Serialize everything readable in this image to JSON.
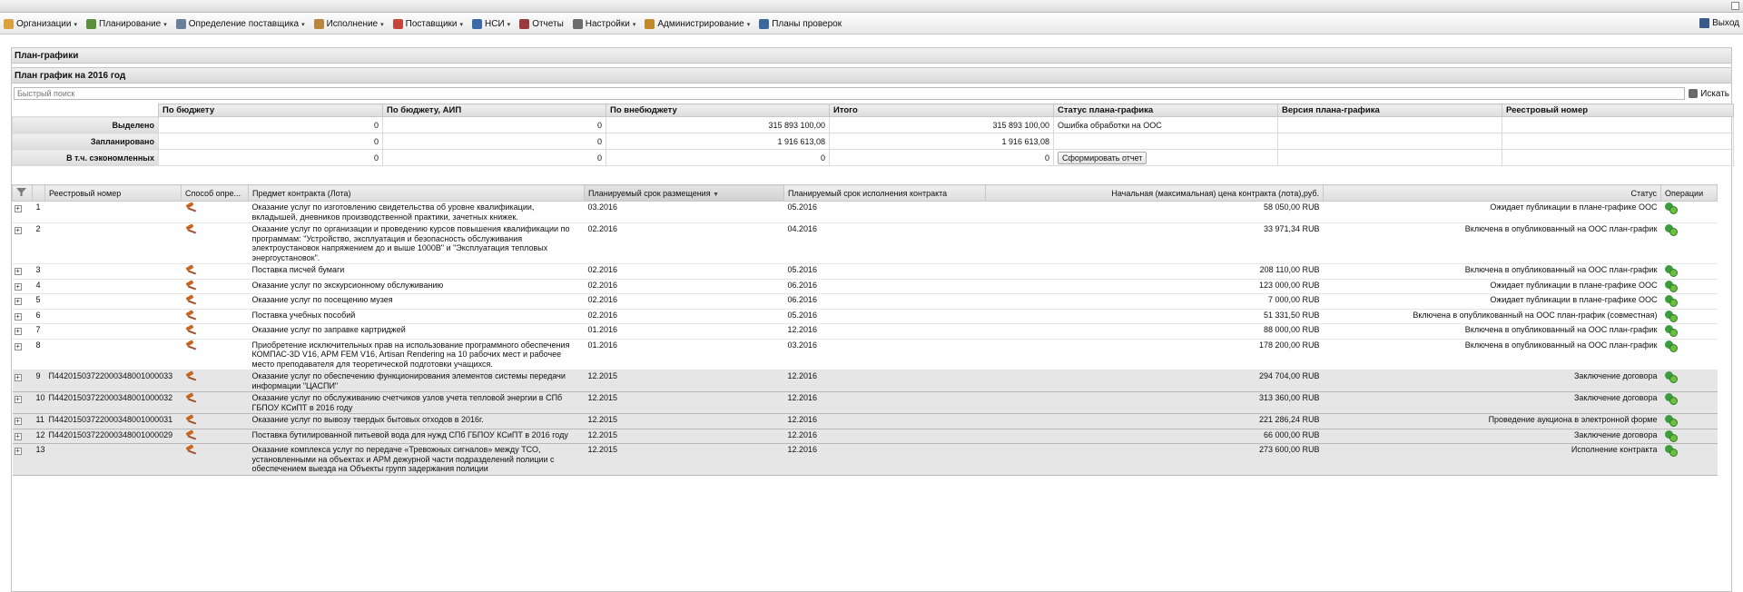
{
  "menu": {
    "items": [
      {
        "label": "Организации",
        "icon": "building-icon",
        "color": "#d9a23a",
        "arrow": true
      },
      {
        "label": "Планирование",
        "icon": "list-icon",
        "color": "#5c8f3a",
        "arrow": true
      },
      {
        "label": "Определение поставщика",
        "icon": "gear-icon",
        "color": "#6a7f9a",
        "arrow": true
      },
      {
        "label": "Исполнение",
        "icon": "briefcase-icon",
        "color": "#b8863c",
        "arrow": true
      },
      {
        "label": "Поставщики",
        "icon": "truck-icon",
        "color": "#c4463a",
        "arrow": true
      },
      {
        "label": "НСИ",
        "icon": "table-icon",
        "color": "#3a6aa8",
        "arrow": true
      },
      {
        "label": "Отчеты",
        "icon": "report-icon",
        "color": "#9a3a3a",
        "arrow": false
      },
      {
        "label": "Настройки",
        "icon": "wrench-icon",
        "color": "#6a6a6a",
        "arrow": true
      },
      {
        "label": "Администрирование",
        "icon": "user-icon",
        "color": "#c08a2a",
        "arrow": true
      },
      {
        "label": "Планы проверок",
        "icon": "user-check-icon",
        "color": "#3a6a9a",
        "arrow": false
      }
    ],
    "logout": "Выход"
  },
  "section_title": "План-графики",
  "plan_title": "План график на 2016 год",
  "search": {
    "placeholder": "Быстрый поиск",
    "button": "Искать"
  },
  "summary": {
    "headers": [
      "По бюджету",
      "По бюджету, АИП",
      "По внебюджету",
      "Итого",
      "Статус плана-графика",
      "Версия плана-графика",
      "Реестровый номер"
    ],
    "rows": [
      {
        "label": "Выделено",
        "values": [
          "0",
          "0",
          "315 893 100,00",
          "315 893 100,00"
        ],
        "status": "Ошибка обработки на ООС"
      },
      {
        "label": "Запланировано",
        "values": [
          "0",
          "0",
          "1 916 613,08",
          "1 916 613,08"
        ],
        "status": ""
      },
      {
        "label": "В т.ч. сэкономленных",
        "values": [
          "0",
          "0",
          "0",
          "0"
        ],
        "status": ""
      }
    ],
    "report_button": "Сформировать отчет"
  },
  "grid": {
    "headers": [
      "",
      "",
      "Реестровый номер",
      "Способ опре...",
      "Предмет контракта (Лота)",
      "Планируемый срок размещения",
      "Планируемый срок исполнения контракта",
      "Начальная (максимальная) цена контракта (лота),руб.",
      "Статус",
      "Операции"
    ],
    "rows": [
      {
        "n": "1",
        "reg": "",
        "subject": "Оказание услуг по изготовлению свидетельства об уровне квалификации, вкладышей, дневников производственной практики, зачетных книжек.",
        "place": "03.2016",
        "exec": "05.2016",
        "price": "58 050,00 RUB",
        "status": "Ожидает публикации в плане-графике ООС",
        "grey": false
      },
      {
        "n": "2",
        "reg": "",
        "subject": "Оказание услуг по организации и проведению курсов повышения квалификации по программам: \"Устройство, эксплуатация и безопасность обслуживания электроустановок напряжением до и выше 1000В\" и \"Эксплуатация тепловых энергоустановок\".",
        "place": "02.2016",
        "exec": "04.2016",
        "price": "33 971,34 RUB",
        "status": "Включена в опубликованный на ООС план-график",
        "grey": false
      },
      {
        "n": "3",
        "reg": "",
        "subject": "Поставка писчей бумаги",
        "place": "02.2016",
        "exec": "05.2016",
        "price": "208 110,00 RUB",
        "status": "Включена в опубликованный на ООС план-график",
        "grey": false
      },
      {
        "n": "4",
        "reg": "",
        "subject": "Оказание услуг по экскурсионному обслуживанию",
        "place": "02.2016",
        "exec": "06.2016",
        "price": "123 000,00 RUB",
        "status": "Ожидает публикации в плане-графике ООС",
        "grey": false
      },
      {
        "n": "5",
        "reg": "",
        "subject": "Оказание услуг по посещению музея",
        "place": "02.2016",
        "exec": "06.2016",
        "price": "7 000,00 RUB",
        "status": "Ожидает публикации в плане-графике ООС",
        "grey": false
      },
      {
        "n": "6",
        "reg": "",
        "subject": "Поставка учебных пособий",
        "place": "02.2016",
        "exec": "05.2016",
        "price": "51 331,50 RUB",
        "status": "Включена в опубликованный на ООС план-график (совместная)",
        "grey": false
      },
      {
        "n": "7",
        "reg": "",
        "subject": "Оказание услуг по заправке картриджей",
        "place": "01.2016",
        "exec": "12.2016",
        "price": "88 000,00 RUB",
        "status": "Включена в опубликованный на ООС план-график",
        "grey": false
      },
      {
        "n": "8",
        "reg": "",
        "subject": "Приобретение исключительных прав на использование программного обеспечения КОМПАС-3D V16, APM FEM V16, Artisan Rendering на 10 рабочих мест и рабочее место преподавателя для теоретической подготовки учащихся.",
        "place": "01.2016",
        "exec": "03.2016",
        "price": "178 200,00 RUB",
        "status": "Включена в опубликованный на ООС план-график",
        "grey": false
      },
      {
        "n": "9",
        "reg": "П44201503722000348001000033",
        "subject": "Оказание услуг по обеспечению функционирования элементов системы передачи информации \"ЦАСПИ\"",
        "place": "12.2015",
        "exec": "12.2016",
        "price": "294 704,00 RUB",
        "status": "Заключение договора",
        "grey": true
      },
      {
        "n": "10",
        "reg": "П44201503722000348001000032",
        "subject": "Оказание услуг по обслуживанию счетчиков узлов учета тепловой энергии в СПб ГБПОУ КСиПТ в 2016 году",
        "place": "12.2015",
        "exec": "12.2016",
        "price": "313 360,00 RUB",
        "status": "Заключение договора",
        "grey": true
      },
      {
        "n": "11",
        "reg": "П44201503722000348001000031",
        "subject": "Оказание услуг по вывозу твердых бытовых отходов в 2016г.",
        "place": "12.2015",
        "exec": "12.2016",
        "price": "221 286,24 RUB",
        "status": "Проведение аукциона в электронной форме",
        "grey": true
      },
      {
        "n": "12",
        "reg": "П44201503722000348001000029",
        "subject": "Поставка бутилированной питьевой вода для нужд СПб ГБПОУ КСиПТ в 2016 году",
        "place": "12.2015",
        "exec": "12.2016",
        "price": "66 000,00 RUB",
        "status": "Заключение договора",
        "grey": true
      },
      {
        "n": "13",
        "reg": "",
        "subject": "Оказание комплекса услуг по передаче «Тревожных сигналов» между ТСО, установленными на объектах и АРМ дежурной части подразделений полиции с обеспечением выезда на Объекты групп задержания полиции",
        "place": "12.2015",
        "exec": "12.2016",
        "price": "273 600,00 RUB",
        "status": "Исполнение контракта",
        "grey": true
      }
    ]
  }
}
